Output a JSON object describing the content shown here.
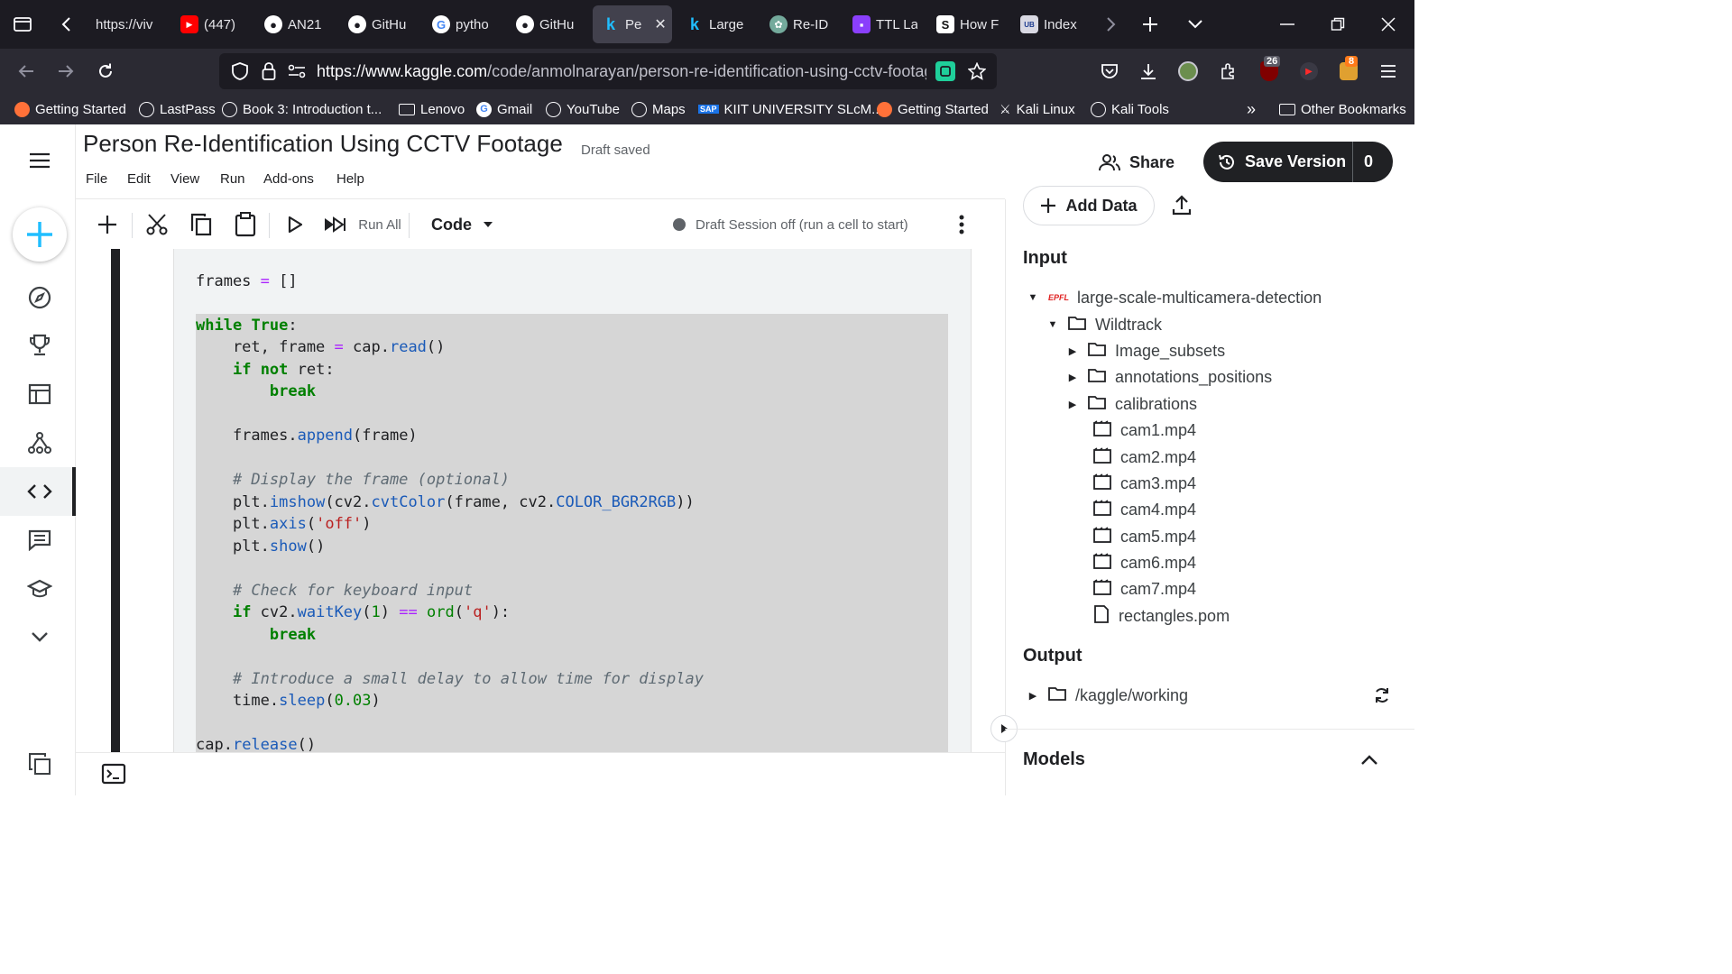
{
  "browser": {
    "tabs": [
      {
        "label": "https://viv",
        "icon": "page-icon"
      },
      {
        "label": "(447)",
        "icon": "youtube-icon"
      },
      {
        "label": "AN21",
        "icon": "github-icon"
      },
      {
        "label": "GitHu",
        "icon": "github-icon"
      },
      {
        "label": "pytho",
        "icon": "google-icon"
      },
      {
        "label": "GitHu",
        "icon": "github-icon"
      },
      {
        "label": "Pe",
        "icon": "kaggle-icon",
        "active": true
      },
      {
        "label": "Large",
        "icon": "kaggle-icon"
      },
      {
        "label": "Re-ID",
        "icon": "chatgpt-icon"
      },
      {
        "label": "TTL La",
        "icon": "app-icon"
      },
      {
        "label": "How F",
        "icon": "s-icon"
      },
      {
        "label": "Index",
        "icon": "ub-icon"
      }
    ],
    "url_host": "https://www.kaggle.com",
    "url_path": "/code/anmolnarayan/person-re-identification-using-cctv-footage/",
    "badges": {
      "ublock": "26",
      "extension": "8"
    },
    "bookmarks": [
      "Getting Started",
      "LastPass",
      "Book 3: Introduction t...",
      "Lenovo",
      "Gmail",
      "YouTube",
      "Maps",
      "KIIT UNIVERSITY SLcM...",
      "Getting Started",
      "Kali Linux",
      "Kali Tools",
      "Other Bookmarks"
    ]
  },
  "notebook": {
    "title": "Person Re-Identification Using CCTV Footage",
    "status": "Draft saved",
    "menu": [
      "File",
      "Edit",
      "View",
      "Run",
      "Add-ons",
      "Help"
    ],
    "share_label": "Share",
    "save_label": "Save Version",
    "save_count": "0",
    "toolbar": {
      "run_all": "Run All",
      "cell_type": "Code",
      "session": "Draft Session off (run a cell to start)"
    }
  },
  "panel": {
    "add_data": "Add Data",
    "input_heading": "Input",
    "dataset": "large-scale-multicamera-detection",
    "dataset_badge": "EPFL",
    "folder": "Wildtrack",
    "subfolders": [
      "Image_subsets",
      "annotations_positions",
      "calibrations"
    ],
    "files": [
      "cam1.mp4",
      "cam2.mp4",
      "cam3.mp4",
      "cam4.mp4",
      "cam5.mp4",
      "cam6.mp4",
      "cam7.mp4",
      "rectangles.pom"
    ],
    "output_heading": "Output",
    "output_path": "/kaggle/working",
    "models_heading": "Models"
  }
}
